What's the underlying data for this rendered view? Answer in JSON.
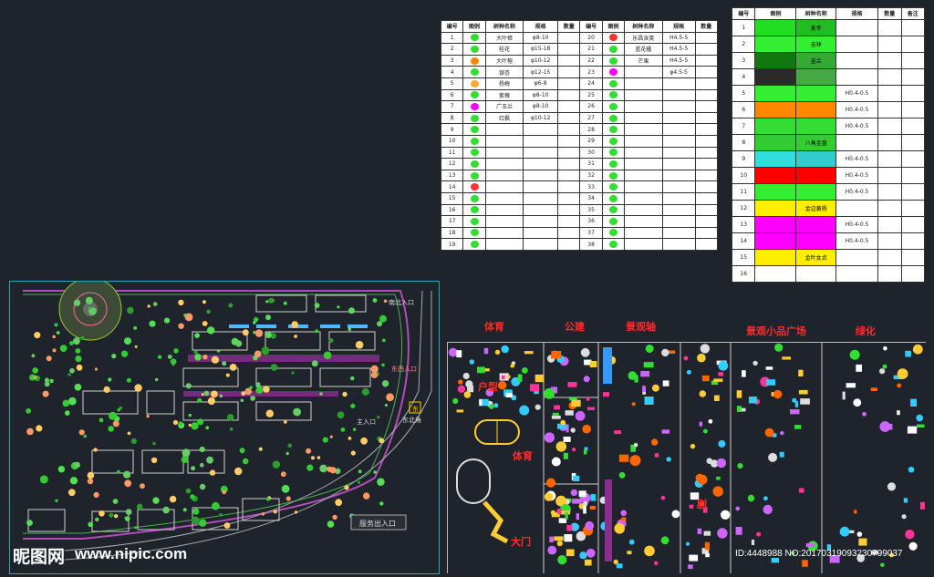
{
  "plant_table": {
    "headers": [
      "编号",
      "图例",
      "树种名称",
      "规格",
      "数量",
      "编号",
      "图例",
      "树种名称",
      "规格",
      "数量"
    ],
    "rows": [
      [
        "1",
        "",
        "大叶樟",
        "φ8-10",
        "",
        "20",
        "",
        "乐昌含笑",
        "H4.5-5",
        ""
      ],
      [
        "2",
        "",
        "桂花",
        "φ15-18",
        "",
        "21",
        "",
        "蓝花楹",
        "H4.5-5",
        ""
      ],
      [
        "3",
        "",
        "大叶榕",
        "φ10-12",
        "",
        "22",
        "",
        "芒果",
        "H4.5-5",
        ""
      ],
      [
        "4",
        "",
        "银杏",
        "φ12-15",
        "",
        "23",
        "",
        "",
        "φ4.5-5",
        ""
      ],
      [
        "5",
        "",
        "杨梅",
        "φ6-8",
        "",
        "24",
        "",
        "",
        "",
        ""
      ],
      [
        "6",
        "",
        "紫薇",
        "φ8-10",
        "",
        "25",
        "",
        "",
        "",
        ""
      ],
      [
        "7",
        "",
        "广玉兰",
        "φ8-10",
        "",
        "26",
        "",
        "",
        "",
        ""
      ],
      [
        "8",
        "",
        "红枫",
        "φ10-12",
        "",
        "27",
        "",
        "",
        "",
        ""
      ],
      [
        "9",
        "",
        "",
        "",
        "",
        "28",
        "",
        "",
        "",
        ""
      ],
      [
        "10",
        "",
        "",
        "",
        "",
        "29",
        "",
        "",
        "",
        ""
      ],
      [
        "11",
        "",
        "",
        "",
        "",
        "30",
        "",
        "",
        "",
        ""
      ],
      [
        "12",
        "",
        "",
        "",
        "",
        "31",
        "",
        "",
        "",
        ""
      ],
      [
        "13",
        "",
        "",
        "",
        "",
        "32",
        "",
        "",
        "",
        ""
      ],
      [
        "14",
        "",
        "",
        "",
        "",
        "33",
        "",
        "",
        "",
        ""
      ],
      [
        "15",
        "",
        "",
        "",
        "",
        "34",
        "",
        "",
        "",
        ""
      ],
      [
        "16",
        "",
        "",
        "",
        "",
        "35",
        "",
        "",
        "",
        ""
      ],
      [
        "17",
        "",
        "",
        "",
        "",
        "36",
        "",
        "",
        "",
        ""
      ],
      [
        "18",
        "",
        "",
        "",
        "",
        "37",
        "",
        "",
        "",
        ""
      ],
      [
        "19",
        "",
        "",
        "",
        "",
        "38",
        "",
        "",
        "",
        ""
      ]
    ],
    "legend_colors": [
      "#33dd33",
      "#33dd33",
      "#ff8800",
      "#33dd33",
      "#ffaa33",
      "#33dd33",
      "#ff00ff",
      "#33dd33",
      "#33dd33",
      "#33dd33",
      "#33dd33",
      "#33dd33",
      "#33dd33",
      "#ff3333",
      "#33dd33",
      "#33dd33",
      "#33dd33",
      "#33dd33",
      "#33dd33"
    ],
    "legend_colors_right": [
      "#ff3333",
      "#33dd33",
      "#33dd33",
      "#ff00ff",
      "#33dd33",
      "#33dd33",
      "#33dd33",
      "#33dd33",
      "#33dd33",
      "#33dd33",
      "#33dd33",
      "#33dd33",
      "#33dd33",
      "#33dd33",
      "#33dd33",
      "#33dd33",
      "#33dd33",
      "#33dd33",
      "#33dd33"
    ]
  },
  "ground_table": {
    "headers": [
      "编号",
      "图例",
      "树种名称",
      "规格",
      "数量",
      "备注"
    ],
    "rows": [
      [
        "1",
        "",
        "麦冬",
        "",
        "",
        "",
        "#22dd22",
        "#22bb22"
      ],
      [
        "2",
        "",
        "吉祥",
        "",
        "",
        "",
        "#33ee33",
        "#33ee33"
      ],
      [
        "3",
        "",
        "韭兰",
        "",
        "",
        "",
        "#117711",
        "#33aa33"
      ],
      [
        "4",
        "",
        "",
        "",
        "",
        "",
        "#2a2a2a",
        "#44aa44"
      ],
      [
        "5",
        "",
        "",
        "H0.4-0.5",
        "",
        "",
        "#33ee33",
        "#33ee33"
      ],
      [
        "6",
        "",
        "",
        "H0.4-0.5",
        "",
        "",
        "#ff8800",
        "#ff8800"
      ],
      [
        "7",
        "",
        "",
        "H0.4-0.5",
        "",
        "",
        "#33dd33",
        "#33dd33"
      ],
      [
        "8",
        "",
        "八角金盘",
        "",
        "",
        "",
        "#33cc33",
        "#33cc33"
      ],
      [
        "9",
        "",
        "",
        "H0.4-0.5",
        "",
        "",
        "#33dddd",
        "#33cccc"
      ],
      [
        "10",
        "",
        "",
        "H0.4-0.5",
        "",
        "",
        "#ff0000",
        "#ff0000"
      ],
      [
        "11",
        "",
        "",
        "H0.4-0.5",
        "",
        "",
        "#33ee33",
        "#33ee33"
      ],
      [
        "12",
        "",
        "金边黄杨",
        "",
        "",
        "",
        "#ffee00",
        "#ffee00"
      ],
      [
        "13",
        "",
        "",
        "H0.4-0.5",
        "",
        "",
        "#ff00ff",
        "#ff00ff"
      ],
      [
        "14",
        "",
        "",
        "H0.4-0.5",
        "",
        "",
        "#ff00ff",
        "#ff00ff"
      ],
      [
        "15",
        "",
        "金叶女贞",
        "",
        "",
        "",
        "#ffee00",
        "#ffee00"
      ],
      [
        "16",
        "",
        "",
        "",
        "",
        "",
        "#ffffff",
        "#ffffff"
      ]
    ]
  },
  "categories": {
    "sports": "体育",
    "public": "公建",
    "landscape": "景观轴",
    "plaza": "景观小品广场",
    "green": "绿化",
    "outdoor": "户型",
    "sports2": "体育",
    "gate": "大门",
    "misc": "剧"
  },
  "site_labels": {
    "gate_north": "南北入口",
    "gate_east": "东西入口",
    "main_entrance": "主入口",
    "exit_entrance": "服务出入口",
    "east_tag": "东北角",
    "legend_badge": "东"
  },
  "watermark": {
    "brand": "昵图网",
    "url": "www.nipic.com",
    "id_text": "ID:4448988 NO:20170319093230799037"
  }
}
